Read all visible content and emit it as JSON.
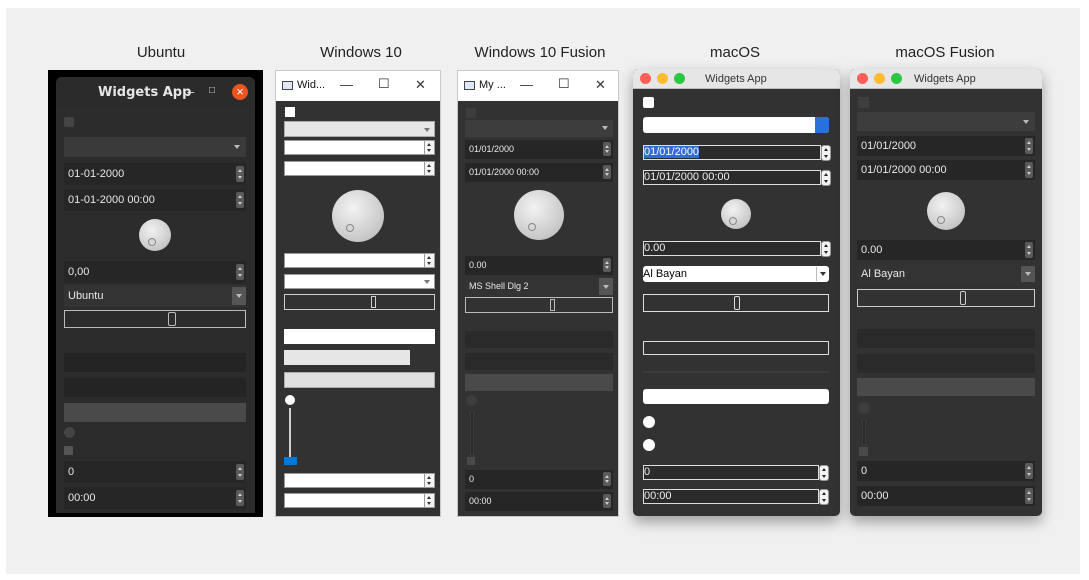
{
  "platforms": {
    "ubuntu": {
      "label": "Ubuntu",
      "window_title": "Widgets App",
      "minimize_glyph": "–",
      "maximize_glyph": "□",
      "close_glyph": "×",
      "date_value": "01-01-2000",
      "datetime_value": "01-01-2000 00:00",
      "double_value": "0,00",
      "font_value": "Ubuntu",
      "int_value": "0",
      "time_value": "00:00"
    },
    "windows10": {
      "label": "Windows 10",
      "window_title": "Wid...",
      "minimize_glyph": "—",
      "maximize_glyph": "☐",
      "close_glyph": "✕"
    },
    "windows10_fusion": {
      "label": "Windows 10 Fusion",
      "window_title": "My ...",
      "minimize_glyph": "—",
      "maximize_glyph": "☐",
      "close_glyph": "✕",
      "date_value": "01/01/2000",
      "datetime_value": "01/01/2000 00:00",
      "double_value": "0.00",
      "font_value": "MS Shell Dlg 2",
      "int_value": "0",
      "time_value": "00:00"
    },
    "macos": {
      "label": "macOS",
      "window_title": "Widgets App",
      "date_value": "01/01/2000",
      "datetime_value": "01/01/2000 00:00",
      "double_value": "0.00",
      "font_value": "Al Bayan",
      "int_value": "0",
      "time_value": "00:00"
    },
    "macos_fusion": {
      "label": "macOS Fusion",
      "window_title": "Widgets App",
      "date_value": "01/01/2000",
      "datetime_value": "01/01/2000 00:00",
      "double_value": "0.00",
      "font_value": "Al Bayan",
      "int_value": "0",
      "time_value": "00:00"
    }
  },
  "colors": {
    "dark_window": "#323232",
    "dark_field": "#262626",
    "ubuntu_close": "#e95420",
    "mac_red": "#ff5f57",
    "mac_yellow": "#febc2e",
    "mac_green": "#28c840",
    "mac_selection": "#2a6fdb",
    "win_slider_accent": "#0078d7"
  },
  "icons": [
    "app-icon",
    "close-icon",
    "minimize-icon",
    "maximize-icon",
    "chevron-down-icon",
    "spin-arrows-icon",
    "dial-knob",
    "checkbox",
    "radio-button"
  ]
}
